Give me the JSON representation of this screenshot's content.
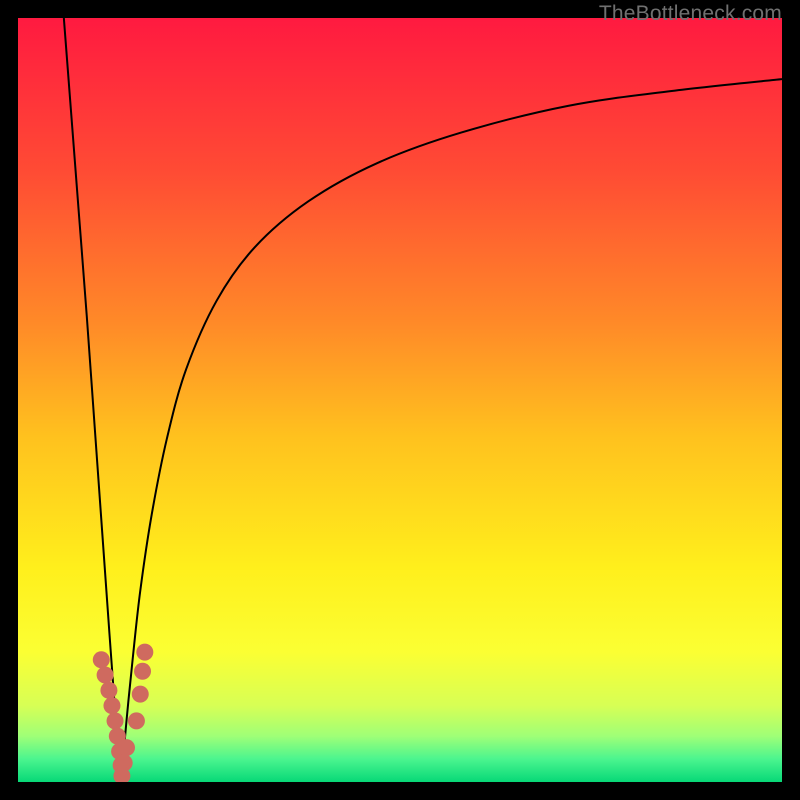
{
  "watermark": "TheBottleneck.com",
  "colors": {
    "frame": "#000000",
    "curve": "#000000",
    "marker": "#cf6a5f",
    "gradient_stops": [
      {
        "offset": 0.0,
        "color": "#ff1a40"
      },
      {
        "offset": 0.2,
        "color": "#ff4b34"
      },
      {
        "offset": 0.4,
        "color": "#ff8a28"
      },
      {
        "offset": 0.55,
        "color": "#ffc21e"
      },
      {
        "offset": 0.72,
        "color": "#ffef1c"
      },
      {
        "offset": 0.83,
        "color": "#fbff33"
      },
      {
        "offset": 0.9,
        "color": "#d7ff55"
      },
      {
        "offset": 0.94,
        "color": "#9fff77"
      },
      {
        "offset": 0.97,
        "color": "#4bf58f"
      },
      {
        "offset": 1.0,
        "color": "#07d877"
      }
    ]
  },
  "chart_data": {
    "type": "line",
    "title": "",
    "xlabel": "",
    "ylabel": "",
    "xlim": [
      0,
      100
    ],
    "ylim": [
      0,
      100
    ],
    "x_opt": 13.5,
    "series": [
      {
        "name": "left",
        "x": [
          6.0,
          7.0,
          8.0,
          9.0,
          10.0,
          11.0,
          12.0,
          12.8,
          13.5
        ],
        "values": [
          100,
          87,
          74,
          61,
          47,
          33,
          19,
          8,
          0
        ]
      },
      {
        "name": "right",
        "x": [
          13.5,
          14.2,
          15.0,
          16.0,
          17.5,
          19.5,
          22.0,
          26.0,
          31.0,
          38.0,
          47.0,
          58.0,
          72.0,
          86.0,
          100.0
        ],
        "values": [
          0,
          8,
          16,
          25,
          35,
          45,
          54,
          63,
          70,
          76,
          81,
          85,
          88.5,
          90.5,
          92.0
        ]
      }
    ],
    "markers": [
      {
        "x": 10.9,
        "y": 16.0
      },
      {
        "x": 11.4,
        "y": 14.0
      },
      {
        "x": 11.9,
        "y": 12.0
      },
      {
        "x": 12.3,
        "y": 10.0
      },
      {
        "x": 12.7,
        "y": 8.0
      },
      {
        "x": 13.0,
        "y": 6.0
      },
      {
        "x": 13.3,
        "y": 4.0
      },
      {
        "x": 13.5,
        "y": 2.2
      },
      {
        "x": 13.6,
        "y": 0.8
      },
      {
        "x": 13.9,
        "y": 2.5
      },
      {
        "x": 14.2,
        "y": 4.5
      },
      {
        "x": 15.5,
        "y": 8.0
      },
      {
        "x": 16.0,
        "y": 11.5
      },
      {
        "x": 16.3,
        "y": 14.5
      },
      {
        "x": 16.6,
        "y": 17.0
      }
    ]
  }
}
